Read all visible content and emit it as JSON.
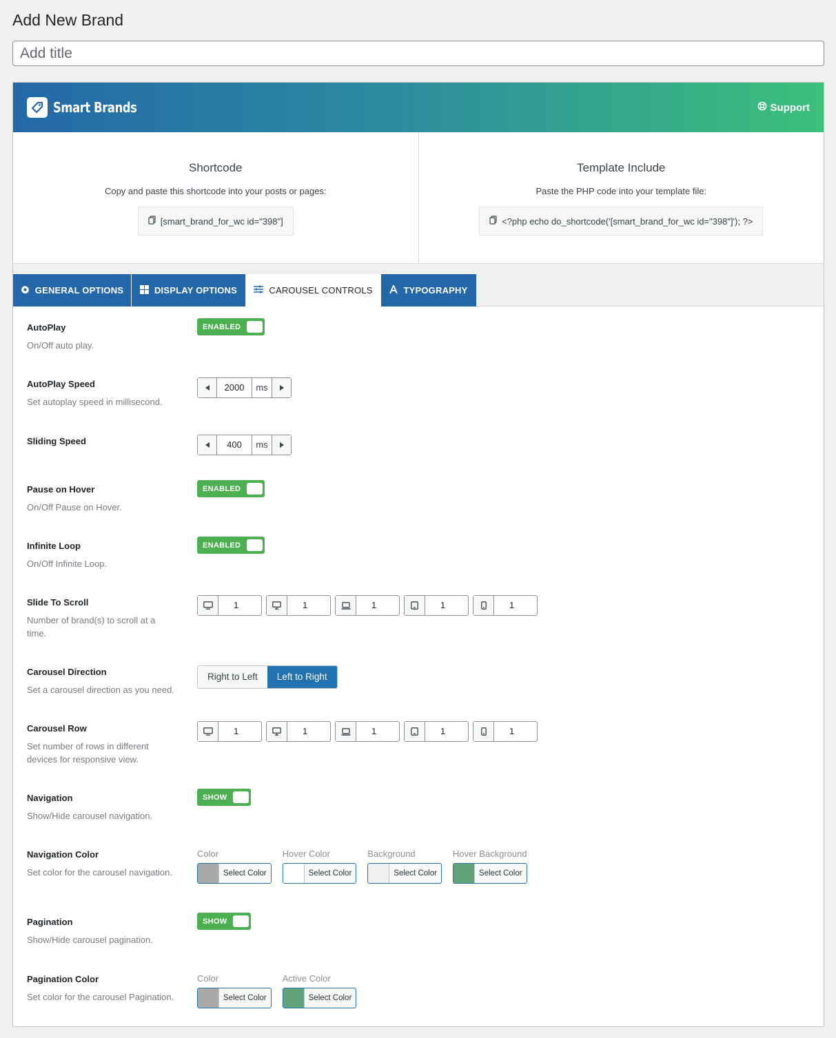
{
  "page": {
    "title": "Add New Brand",
    "title_placeholder": "Add title"
  },
  "banner": {
    "brand_name": "Smart Brands",
    "support_label": "Support",
    "colors": {
      "start": "#2468a8",
      "end": "#3cc07a"
    }
  },
  "shortcode": {
    "title": "Shortcode",
    "description": "Copy and paste this shortcode into your posts or pages:",
    "code": "[smart_brand_for_wc id=\"398\"]"
  },
  "template_include": {
    "title": "Template Include",
    "description": "Paste the PHP code into your template file:",
    "code": "<?php echo do_shortcode('[smart_brand_for_wc id=\"398\"]'); ?>"
  },
  "tabs": [
    {
      "label": "GENERAL OPTIONS",
      "icon": "gear-icon"
    },
    {
      "label": "DISPLAY OPTIONS",
      "icon": "grid-icon"
    },
    {
      "label": "CAROUSEL CONTROLS",
      "icon": "sliders-icon",
      "active": true
    },
    {
      "label": "TYPOGRAPHY",
      "icon": "font-icon"
    }
  ],
  "settings": {
    "autoplay": {
      "title": "AutoPlay",
      "desc": "On/Off auto play.",
      "toggle": "ENABLED"
    },
    "autoplay_speed": {
      "title": "AutoPlay Speed",
      "desc": "Set autoplay speed in millisecond.",
      "value": "2000",
      "unit": "ms"
    },
    "sliding_speed": {
      "title": "Sliding Speed",
      "value": "400",
      "unit": "ms"
    },
    "pause_on_hover": {
      "title": "Pause on Hover",
      "desc": "On/Off Pause on Hover.",
      "toggle": "ENABLED"
    },
    "infinite_loop": {
      "title": "Infinite Loop",
      "desc": "On/Off Infinite Loop.",
      "toggle": "ENABLED"
    },
    "slide_to_scroll": {
      "title": "Slide To Scroll",
      "desc": "Number of brand(s) to scroll at a time.",
      "values": [
        "1",
        "1",
        "1",
        "1",
        "1"
      ]
    },
    "carousel_direction": {
      "title": "Carousel Direction",
      "desc": "Set a carousel direction as you need.",
      "options": [
        "Right to Left",
        "Left to Right"
      ],
      "selected": "Left to Right"
    },
    "carousel_row": {
      "title": "Carousel Row",
      "desc": "Set number of rows in different devices for responsive view.",
      "values": [
        "1",
        "1",
        "1",
        "1",
        "1"
      ]
    },
    "navigation": {
      "title": "Navigation",
      "desc": "Show/Hide carousel navigation.",
      "toggle": "SHOW"
    },
    "navigation_color": {
      "title": "Navigation Color",
      "desc": "Set color for the carousel navigation.",
      "items": [
        {
          "label": "Color",
          "button": "Select Color",
          "swatch": "#a9a9a9"
        },
        {
          "label": "Hover Color",
          "button": "Select Color",
          "swatch": "#ffffff"
        },
        {
          "label": "Background",
          "button": "Select Color",
          "swatch": "#f0f0f0"
        },
        {
          "label": "Hover Background",
          "button": "Select Color",
          "swatch": "#63a37a"
        }
      ]
    },
    "pagination": {
      "title": "Pagination",
      "desc": "Show/Hide carousel pagination.",
      "toggle": "SHOW"
    },
    "pagination_color": {
      "title": "Pagination Color",
      "desc": "Set color for the carousel Pagination.",
      "items": [
        {
          "label": "Color",
          "button": "Select Color",
          "swatch": "#a9a9a9"
        },
        {
          "label": "Active Color",
          "button": "Select Color",
          "swatch": "#63a37a"
        }
      ]
    }
  }
}
